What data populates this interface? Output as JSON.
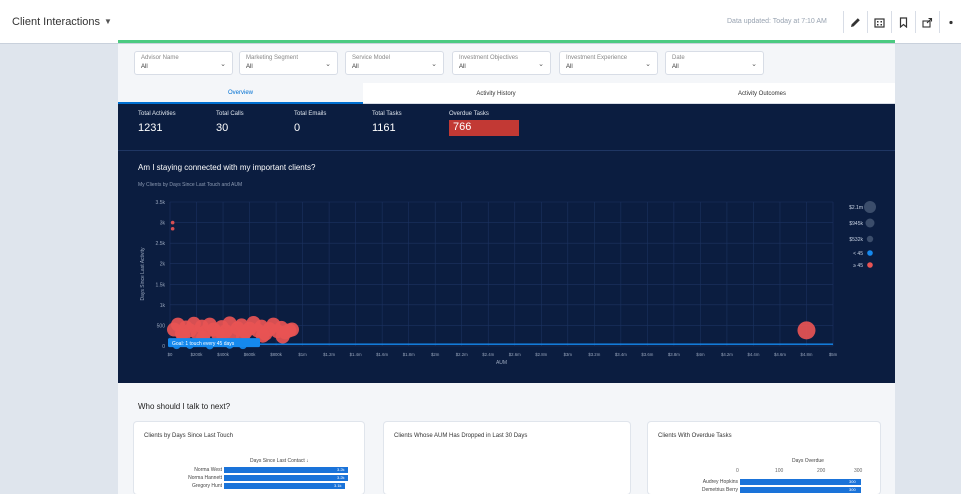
{
  "app": {
    "title": "Client Interactions",
    "updated": "Data updated: Today at 7:10 AM"
  },
  "toolbar": {
    "icons": [
      "pencil-icon",
      "building-icon",
      "bookmark-icon",
      "share-icon",
      "more-icon"
    ]
  },
  "filters": [
    {
      "label": "Advisor Name",
      "value": "All"
    },
    {
      "label": "Marketing Segment",
      "value": "All"
    },
    {
      "label": "Service Model",
      "value": "All"
    },
    {
      "label": "Investment Objectives",
      "value": "All"
    },
    {
      "label": "Investment Experience",
      "value": "All"
    },
    {
      "label": "Date",
      "value": "All"
    }
  ],
  "tabs": [
    {
      "label": "Overview",
      "active": true
    },
    {
      "label": "Activity History",
      "active": false
    },
    {
      "label": "Activity Outcomes",
      "active": false
    }
  ],
  "kpis": [
    {
      "label": "Total Activities",
      "value": "1231"
    },
    {
      "label": "Total Calls",
      "value": "30"
    },
    {
      "label": "Total Emails",
      "value": "0"
    },
    {
      "label": "Total Tasks",
      "value": "1161"
    },
    {
      "label": "Overdue Tasks",
      "value": "766"
    }
  ],
  "colors": {
    "dark_bg": "#0b1d40",
    "red": "#e85454",
    "blue": "#1589ee",
    "accent_green": "#4bca81",
    "kpi_red": "#c23934"
  },
  "chart": {
    "title": "Am I staying connected with my important clients?",
    "subtitle": "My Clients by Days Since Last Touch and AUM",
    "goal_label": "Goal: 1 touch every 45 days"
  },
  "chart_data": {
    "type": "scatter",
    "title": "Am I staying connected with my important clients?",
    "subtitle": "My Clients by Days Since Last Touch and AUM",
    "xlabel": "AUM",
    "ylabel": "Days Since Last Activity",
    "x_ticks": [
      "$0",
      "$200k",
      "$400k",
      "$600k",
      "$800k",
      "$1m",
      "$1.2m",
      "$1.4m",
      "$1.6m",
      "$1.8m",
      "$2m",
      "$2.2m",
      "$2.4m",
      "$2.6m",
      "$2.8m",
      "$3m",
      "$3.2m",
      "$3.4m",
      "$3.6m",
      "$3.8m",
      "$4m",
      "$4.2m",
      "$4.4m",
      "$4.6m",
      "$4.8m",
      "$5m"
    ],
    "y_ticks": [
      "0",
      "500",
      "1k",
      "1.5k",
      "2k",
      "2.5k",
      "3k",
      "3.5k"
    ],
    "ylim": [
      0,
      3500
    ],
    "xlim": [
      0,
      5000000
    ],
    "goal_days": 45,
    "legend": [
      {
        "label": "$2.1m",
        "kind": "size"
      },
      {
        "label": "$945k",
        "kind": "size"
      },
      {
        "label": "$532k",
        "kind": "size"
      },
      {
        "label": "< 45",
        "kind": "color",
        "color": "#1589ee"
      },
      {
        "label": "≥ 45",
        "kind": "color",
        "color": "#e85454"
      }
    ],
    "legend_position": "right",
    "series": [
      {
        "name": "≥ 45",
        "color": "#e85454",
        "points": [
          [
            20000,
            3000
          ],
          [
            20000,
            2850
          ],
          [
            30000,
            400
          ],
          [
            60000,
            520
          ],
          [
            90000,
            300
          ],
          [
            120000,
            450
          ],
          [
            150000,
            380
          ],
          [
            180000,
            540
          ],
          [
            210000,
            300
          ],
          [
            240000,
            470
          ],
          [
            270000,
            350
          ],
          [
            300000,
            520
          ],
          [
            330000,
            400
          ],
          [
            360000,
            300
          ],
          [
            390000,
            460
          ],
          [
            420000,
            360
          ],
          [
            450000,
            550
          ],
          [
            480000,
            320
          ],
          [
            510000,
            430
          ],
          [
            540000,
            500
          ],
          [
            570000,
            340
          ],
          [
            600000,
            420
          ],
          [
            630000,
            560
          ],
          [
            660000,
            380
          ],
          [
            690000,
            470
          ],
          [
            720000,
            300
          ],
          [
            750000,
            410
          ],
          [
            780000,
            520
          ],
          [
            810000,
            360
          ],
          [
            840000,
            440
          ],
          [
            870000,
            330
          ],
          [
            900000,
            380
          ],
          [
            100000,
            250
          ],
          [
            250000,
            200
          ],
          [
            400000,
            260
          ],
          [
            550000,
            230
          ],
          [
            700000,
            250
          ],
          [
            850000,
            230
          ],
          [
            920000,
            400
          ],
          [
            4800000,
            380
          ]
        ]
      },
      {
        "name": "< 45",
        "color": "#1589ee",
        "points": [
          [
            50000,
            20
          ],
          [
            150000,
            25
          ],
          [
            300000,
            15
          ],
          [
            450000,
            30
          ],
          [
            550000,
            20
          ]
        ]
      }
    ]
  },
  "lower": {
    "title": "Who should I talk to next?",
    "cards": [
      {
        "title": "Clients by Days Since Last Touch",
        "column": "Days Since Last Contact ↓",
        "rows": [
          {
            "name": "Norma West",
            "value": "3.2k"
          },
          {
            "name": "Norma Hannett",
            "value": "3.2k"
          },
          {
            "name": "Gregory Hunt",
            "value": "3.1k"
          }
        ]
      },
      {
        "title": "Clients Whose AUM Has Dropped in Last 30 Days"
      },
      {
        "title": "Clients With Overdue Tasks",
        "column": "Days Overdue",
        "ticks": [
          "0",
          "100",
          "200",
          "300"
        ],
        "rows": [
          {
            "name": "Audrey Hopkins",
            "value": "300"
          },
          {
            "name": "Demetrius Berry",
            "value": "300"
          }
        ]
      }
    ]
  }
}
